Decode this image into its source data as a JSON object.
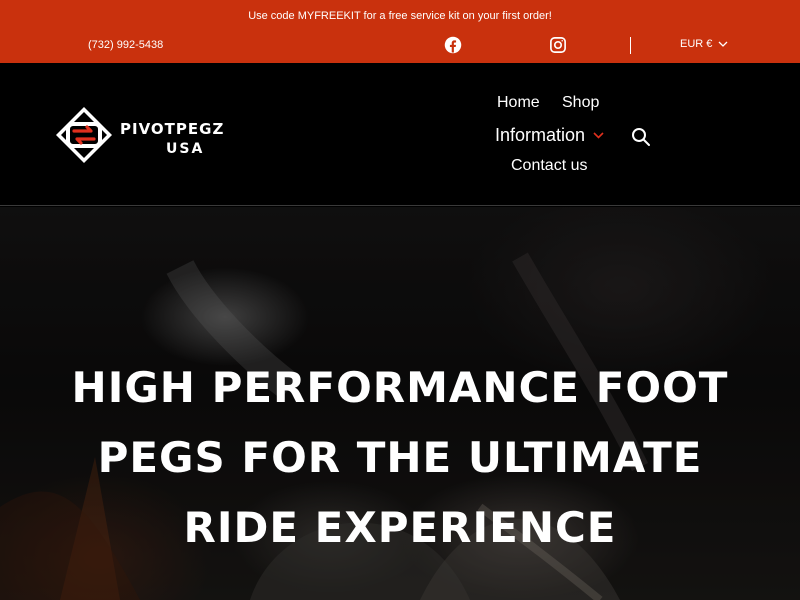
{
  "topbar": {
    "promo": "Use code MYFREEKIT for a free service kit on your first order!",
    "phone": "(732) 992-5438",
    "social": [
      {
        "icon": "facebook-icon"
      },
      {
        "icon": "instagram-icon"
      }
    ],
    "currency": "EUR €"
  },
  "header": {
    "logo": {
      "word": "PIVOTPEGZ",
      "sub": "USA"
    },
    "nav": {
      "home": "Home",
      "shop": "Shop",
      "information": "Information",
      "contact": "Contact us"
    },
    "search_icon": "search-icon"
  },
  "hero": {
    "title": "HIGH PERFORMANCE FOOT PEGS FOR THE ULTIMATE RIDE EXPERIENCE"
  },
  "colors": {
    "brand_red": "#c9310d",
    "header_bg": "#000000",
    "text": "#ffffff"
  }
}
